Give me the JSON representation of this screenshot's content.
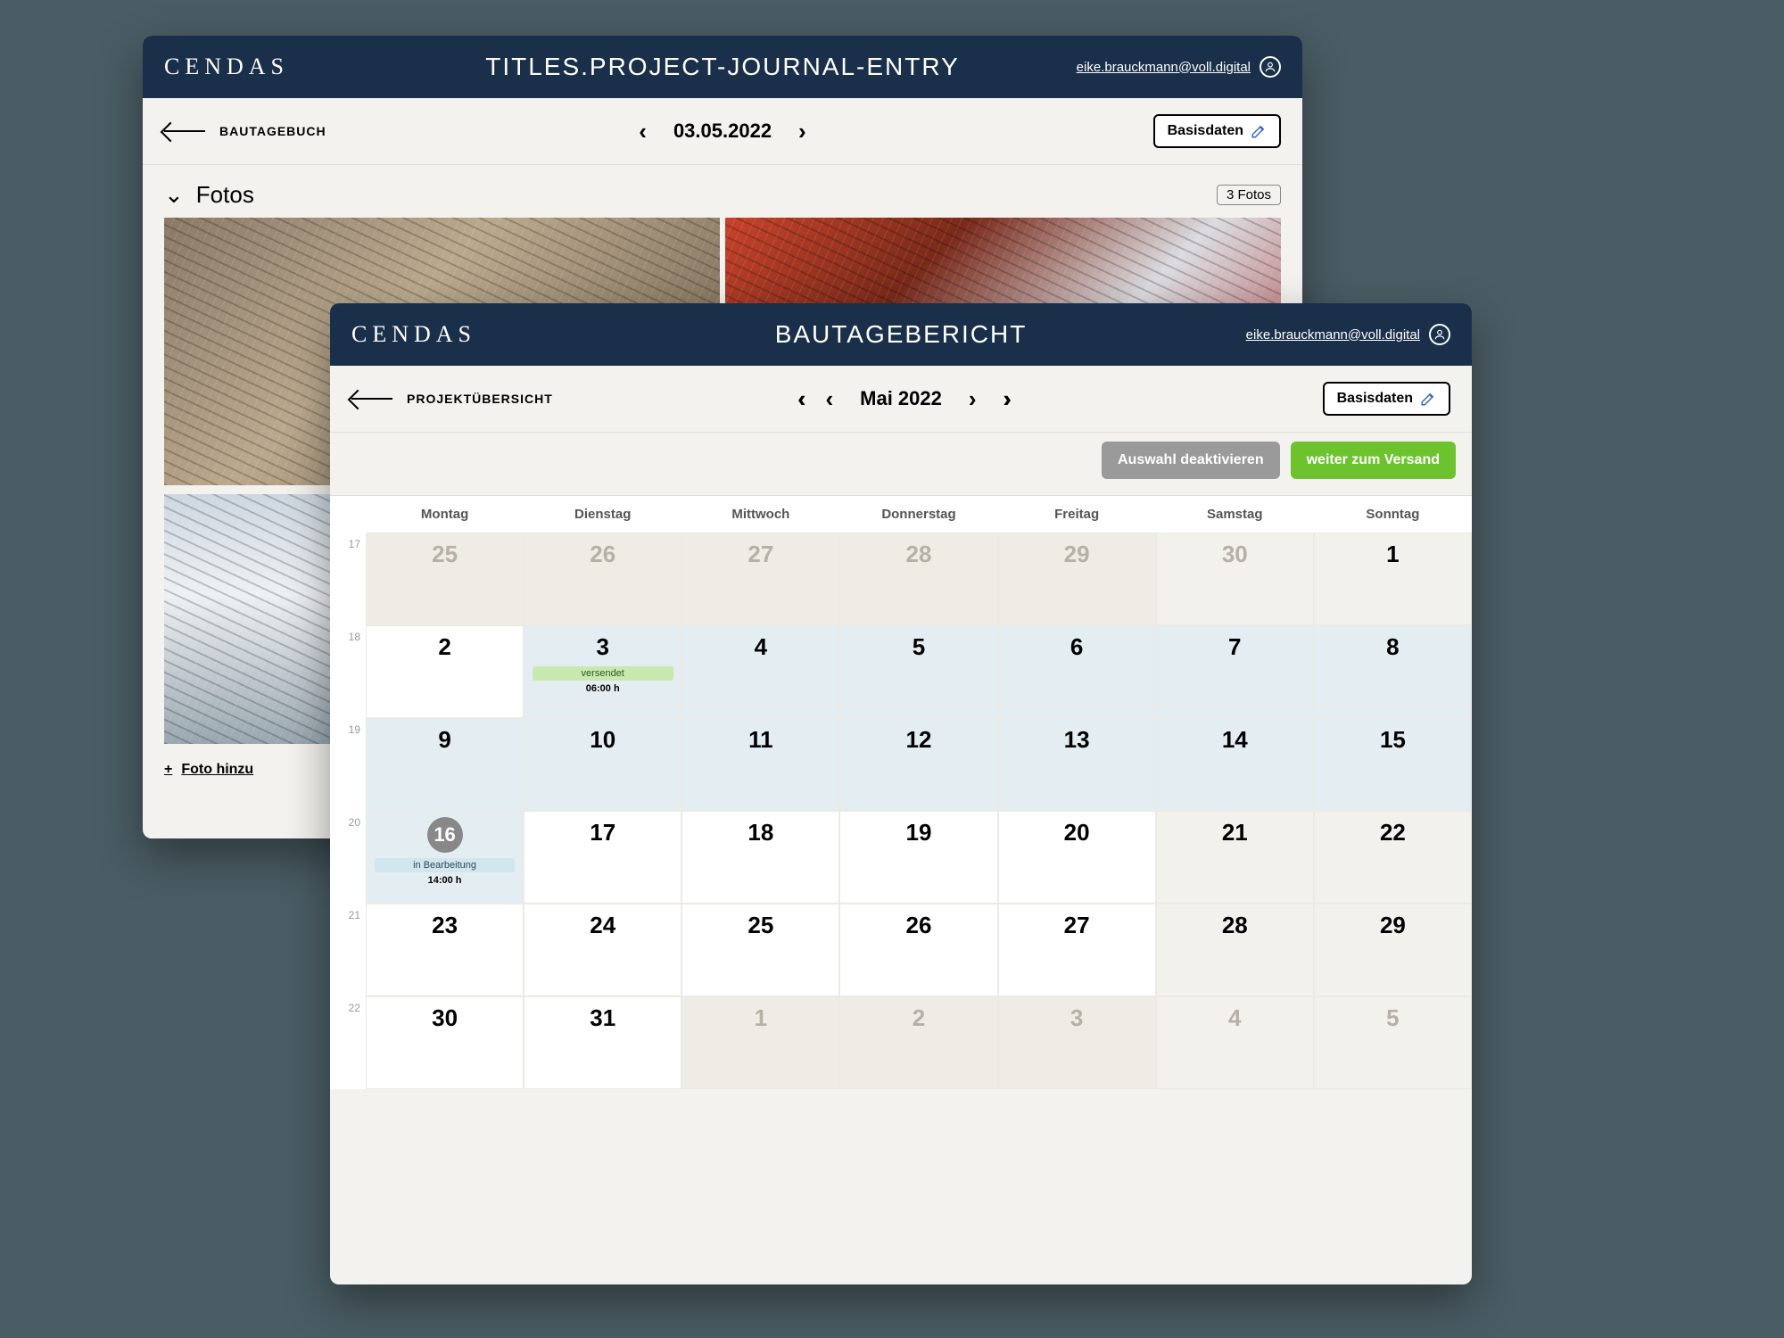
{
  "brand": "CENDAS",
  "user": {
    "email": "eike.brauckmann@voll.digital"
  },
  "back": {
    "title": "TITLES.PROJECT-JOURNAL-ENTRY",
    "breadcrumb": "BAUTAGEBUCH",
    "date": "03.05.2022",
    "basis_button": "Basisdaten",
    "fotos_heading": "Fotos",
    "fotos_badge": "3 Fotos",
    "add_photo": "Foto hinzu"
  },
  "front": {
    "title": "BAUTAGEBERICHT",
    "breadcrumb": "PROJEKTÜBERSICHT",
    "month": "Mai 2022",
    "basis_button": "Basisdaten",
    "btn_deactivate": "Auswahl deaktivieren",
    "btn_send": "weiter zum Versand",
    "weekdays": [
      "Montag",
      "Dienstag",
      "Mittwoch",
      "Donnerstag",
      "Freitag",
      "Samstag",
      "Sonntag"
    ],
    "weeks": [
      {
        "num": "17",
        "days": [
          {
            "n": "25",
            "muted": true
          },
          {
            "n": "26",
            "muted": true
          },
          {
            "n": "27",
            "muted": true
          },
          {
            "n": "28",
            "muted": true
          },
          {
            "n": "29",
            "muted": true
          },
          {
            "n": "30",
            "muted": true,
            "weekend": true
          },
          {
            "n": "1",
            "weekend": true
          }
        ]
      },
      {
        "num": "18",
        "days": [
          {
            "n": "2"
          },
          {
            "n": "3",
            "selected": true,
            "pill": "versendet",
            "pillcls": "green",
            "sub": "06:00 h"
          },
          {
            "n": "4",
            "selected": true
          },
          {
            "n": "5",
            "selected": true
          },
          {
            "n": "6",
            "selected": true
          },
          {
            "n": "7",
            "selected": true,
            "weekend": true
          },
          {
            "n": "8",
            "selected": true,
            "weekend": true
          }
        ]
      },
      {
        "num": "19",
        "days": [
          {
            "n": "9",
            "selected": true
          },
          {
            "n": "10",
            "selected": true
          },
          {
            "n": "11",
            "selected": true
          },
          {
            "n": "12",
            "selected": true
          },
          {
            "n": "13",
            "selected": true
          },
          {
            "n": "14",
            "selected": true,
            "weekend": true
          },
          {
            "n": "15",
            "selected": true,
            "weekend": true
          }
        ]
      },
      {
        "num": "20",
        "days": [
          {
            "n": "16",
            "today": true,
            "selected": true,
            "pill": "in Bearbeitung",
            "pillcls": "blue",
            "sub": "14:00 h"
          },
          {
            "n": "17"
          },
          {
            "n": "18"
          },
          {
            "n": "19"
          },
          {
            "n": "20"
          },
          {
            "n": "21",
            "weekend": true
          },
          {
            "n": "22",
            "weekend": true
          }
        ]
      },
      {
        "num": "21",
        "days": [
          {
            "n": "23"
          },
          {
            "n": "24"
          },
          {
            "n": "25"
          },
          {
            "n": "26"
          },
          {
            "n": "27"
          },
          {
            "n": "28",
            "weekend": true
          },
          {
            "n": "29",
            "weekend": true
          }
        ]
      },
      {
        "num": "22",
        "days": [
          {
            "n": "30"
          },
          {
            "n": "31"
          },
          {
            "n": "1",
            "muted": true
          },
          {
            "n": "2",
            "muted": true
          },
          {
            "n": "3",
            "muted": true
          },
          {
            "n": "4",
            "muted": true,
            "weekend": true
          },
          {
            "n": "5",
            "muted": true,
            "weekend": true
          }
        ]
      }
    ]
  }
}
